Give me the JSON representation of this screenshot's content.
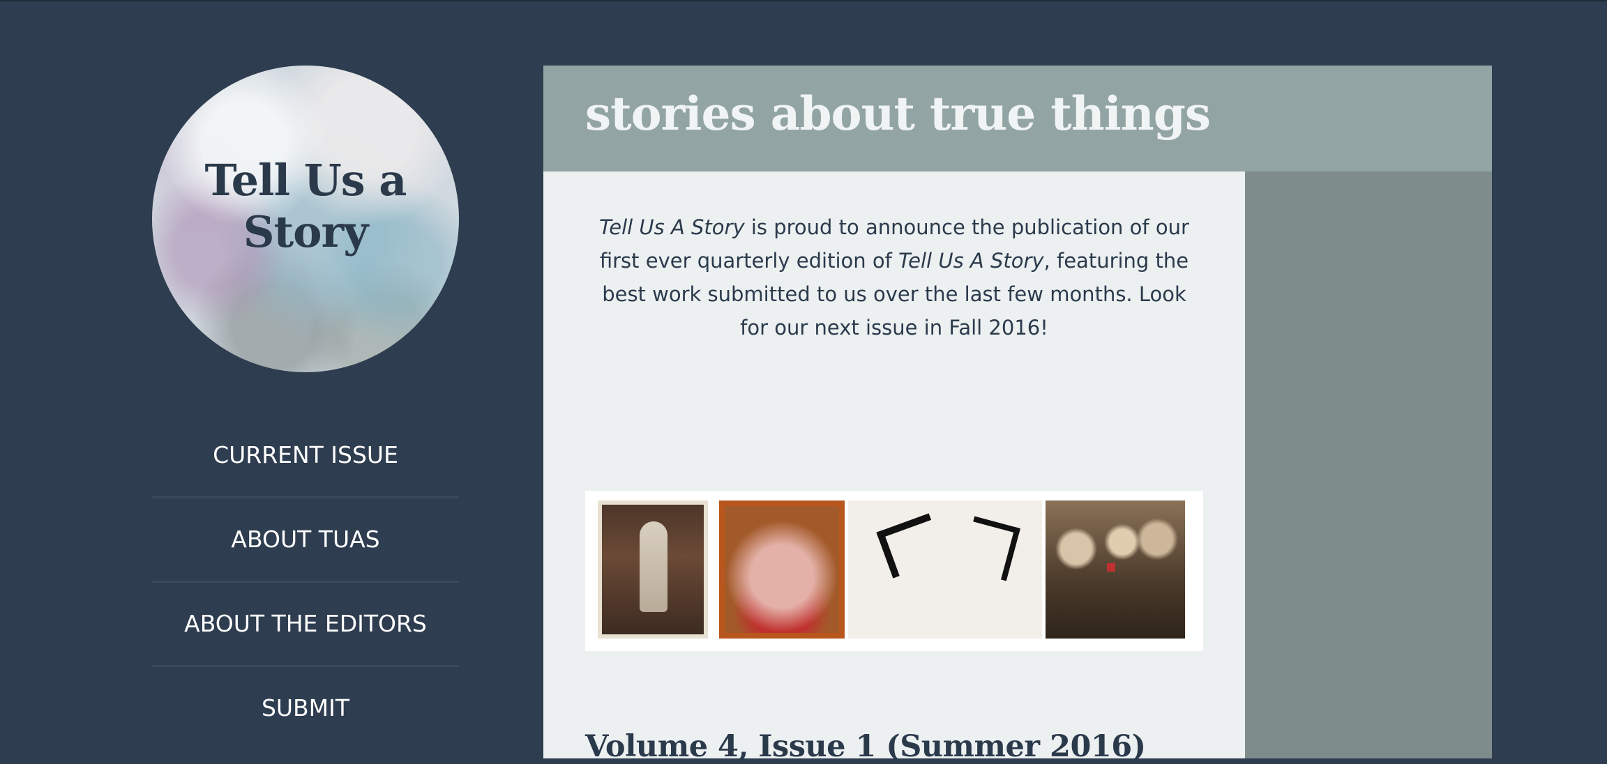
{
  "site": {
    "logo_title": "Tell Us a Story",
    "tagline": "stories about true things"
  },
  "nav": {
    "items": [
      {
        "label": "CURRENT ISSUE"
      },
      {
        "label": "ABOUT TUAS"
      },
      {
        "label": "ABOUT THE EDITORS"
      },
      {
        "label": "SUBMIT"
      }
    ]
  },
  "main": {
    "announcement": {
      "part1": "Tell Us A Story",
      "part2": " is proud to announce the publication of our first ever quarterly edition of ",
      "part3": "Tell Us A Story",
      "part4": ", featuring the best work submitted to us over the last few months. Look for our next issue in Fall 2016!"
    },
    "volume_title": "Volume 4, Issue 1 (Summer 2016)"
  },
  "colors": {
    "background": "#2e3d4f",
    "header_band": "#93a4a4",
    "content": "#ecf0f1",
    "right_column": "#7f8c8c",
    "text_dark": "#2b3a4b"
  }
}
